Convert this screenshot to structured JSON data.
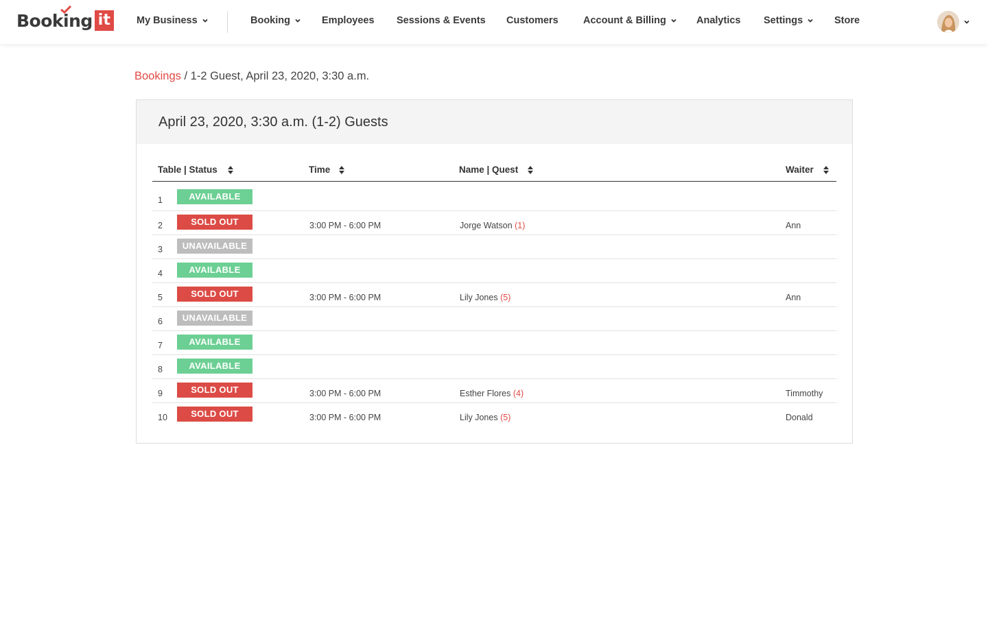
{
  "header": {
    "logo_text": "Booking",
    "logo_badge": "it",
    "nav": [
      {
        "label": "My Business",
        "dropdown": true
      },
      {
        "label": "Booking",
        "dropdown": true
      },
      {
        "label": "Employees",
        "dropdown": false
      },
      {
        "label": "Sessions & Events",
        "dropdown": false
      },
      {
        "label": "Customers",
        "dropdown": false
      },
      {
        "label": "Account & Billing",
        "dropdown": true
      },
      {
        "label": "Analytics",
        "dropdown": false
      },
      {
        "label": "Settings",
        "dropdown": true
      },
      {
        "label": "Store",
        "dropdown": false
      }
    ]
  },
  "breadcrumb": {
    "link": "Bookings",
    "separator": " / ",
    "current": "1-2 Guest, April 23, 2020, 3:30 a.m."
  },
  "card": {
    "title": "April 23, 2020, 3:30 a.m. (1-2) Guests"
  },
  "table": {
    "columns": [
      "Table | Status",
      "Time",
      "Name | Quest",
      "Waiter"
    ],
    "rows": [
      {
        "table": "1",
        "status": "AVAILABLE",
        "status_type": "available",
        "time": "",
        "name": "",
        "guests": "",
        "waiter": ""
      },
      {
        "table": "2",
        "status": "SOLD OUT",
        "status_type": "soldout",
        "time": "3:00 PM - 6:00 PM",
        "name": "Jorge Watson",
        "guests": "(1)",
        "waiter": "Ann"
      },
      {
        "table": "3",
        "status": "UNAVAILABLE",
        "status_type": "unavailable",
        "time": "",
        "name": "",
        "guests": "",
        "waiter": ""
      },
      {
        "table": "4",
        "status": "AVAILABLE",
        "status_type": "available",
        "time": "",
        "name": "",
        "guests": "",
        "waiter": ""
      },
      {
        "table": "5",
        "status": "SOLD OUT",
        "status_type": "soldout",
        "time": "3:00 PM - 6:00 PM",
        "name": "Lily Jones",
        "guests": "(5)",
        "waiter": "Ann"
      },
      {
        "table": "6",
        "status": "UNAVAILABLE",
        "status_type": "unavailable",
        "time": "",
        "name": "",
        "guests": "",
        "waiter": ""
      },
      {
        "table": "7",
        "status": "AVAILABLE",
        "status_type": "available",
        "time": "",
        "name": "",
        "guests": "",
        "waiter": ""
      },
      {
        "table": "8",
        "status": "AVAILABLE",
        "status_type": "available",
        "time": "",
        "name": "",
        "guests": "",
        "waiter": ""
      },
      {
        "table": "9",
        "status": "SOLD OUT",
        "status_type": "soldout",
        "time": "3:00 PM - 6:00 PM",
        "name": "Esther Flores",
        "guests": "(4)",
        "waiter": "Timmothy"
      },
      {
        "table": "10",
        "status": "SOLD OUT",
        "status_type": "soldout",
        "time": "3:00 PM - 6:00 PM",
        "name": "Lily Jones",
        "guests": "(5)",
        "waiter": "Donald"
      }
    ]
  },
  "colors": {
    "brand_red": "#e04a45",
    "available": "#6ccf93",
    "sold_out": "#dc4b45",
    "unavailable": "#bdbdbd"
  }
}
